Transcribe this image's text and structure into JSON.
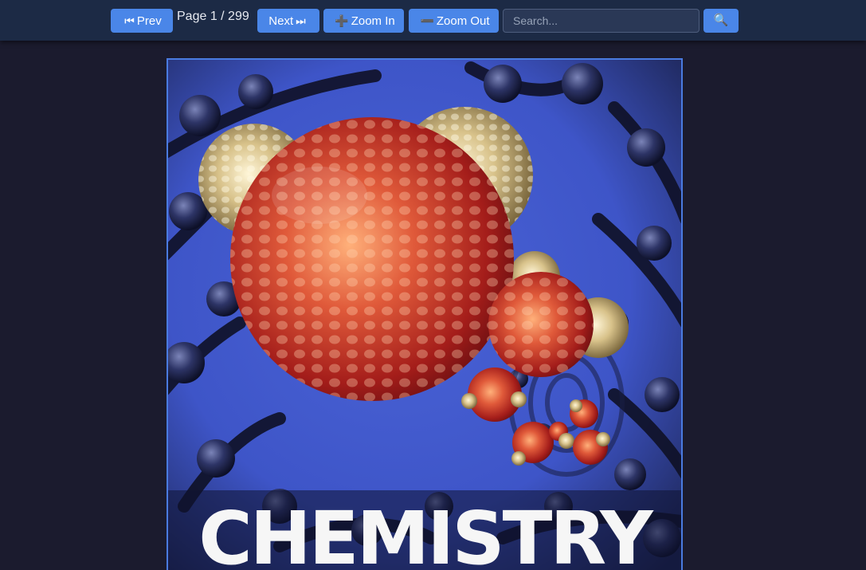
{
  "toolbar": {
    "prev_label": "Prev",
    "prev_icon": "⏮",
    "page_indicator": "Page 1 / 299",
    "next_label": "Next",
    "next_icon": "⏭",
    "zoom_in_label": "Zoom In",
    "zoom_in_icon": "➕",
    "zoom_out_label": "Zoom Out",
    "zoom_out_icon": "➖",
    "search_placeholder": "Search...",
    "search_value": "",
    "search_button_icon": "🔍"
  },
  "document": {
    "cover_title": "CHEMISTRY"
  },
  "colors": {
    "toolbar_bg": "#1c2a45",
    "button": "#4a86e8",
    "page_bg": "#1b1b2e",
    "viewer_border": "#4a7be0"
  }
}
